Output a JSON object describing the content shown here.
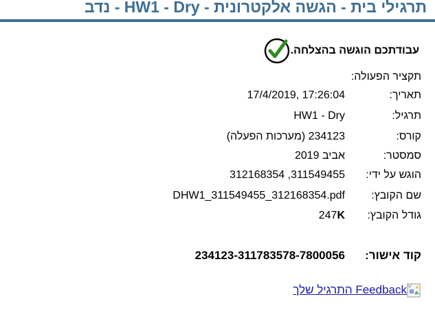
{
  "header": {
    "title": "תרגילי בית - הגשה אלקטרונית - HW1 - Dry - נדב"
  },
  "success": {
    "message": "עבודתכם הוגשה בהצלחה.",
    "icon": "checkmark-circle-icon"
  },
  "summary": {
    "label": "תקציר הפעולה:"
  },
  "fields": {
    "date": {
      "label": "תאריך:",
      "value": "17/4/2019, 17:26:04"
    },
    "exercise": {
      "label": "תרגיל:",
      "value": "HW1 - Dry"
    },
    "course": {
      "label": "קורס:",
      "value": "234123 (מערכות הפעלה)"
    },
    "semester": {
      "label": "סמסטר:",
      "value": "אביב 2019"
    },
    "submitted_by": {
      "label": "הוגש על ידי:",
      "value": "311549455, 312168354"
    },
    "file_name": {
      "label": "שם הקובץ:",
      "value": "DHW1_311549455_312168354.pdf"
    },
    "file_size": {
      "label": "גודל הקובץ:",
      "value": "247",
      "unit": "K"
    }
  },
  "approval": {
    "label": "קוד אישור:",
    "code": "234123-311783578-7800056"
  },
  "feedback": {
    "link_en": "Feedback",
    "link_he": "התרגיל שלך",
    "icon": "broken-image-icon"
  },
  "colors": {
    "header_accent": "#3d6e96",
    "link": "#1a1aa6",
    "check_green": "#2e8b22"
  }
}
